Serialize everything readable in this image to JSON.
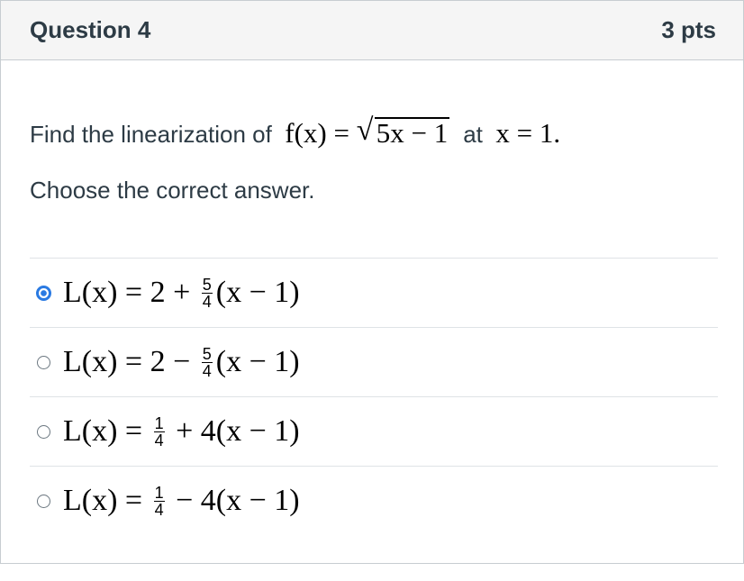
{
  "header": {
    "title": "Question 4",
    "points": "3 pts"
  },
  "question": {
    "prompt_start": "Find the linearization of",
    "function_lhs": "f(x) =",
    "radicand": "5x − 1",
    "at_word": "at",
    "point": "x = 1.",
    "instruction": "Choose the correct answer."
  },
  "answers": [
    {
      "selected": true,
      "pre": "L(x) = 2 + ",
      "num": "5",
      "den": "4",
      "post": "(x − 1)"
    },
    {
      "selected": false,
      "pre": "L(x) = 2 − ",
      "num": "5",
      "den": "4",
      "post": "(x − 1)"
    },
    {
      "selected": false,
      "pre": "L(x) = ",
      "num": "1",
      "den": "4",
      "post": " + 4(x − 1)"
    },
    {
      "selected": false,
      "pre": "L(x) = ",
      "num": "1",
      "den": "4",
      "post": " − 4(x − 1)"
    }
  ],
  "colors": {
    "accent": "#2a7ae2",
    "header_bg": "#f5f5f5",
    "border": "#c7cdd1"
  }
}
